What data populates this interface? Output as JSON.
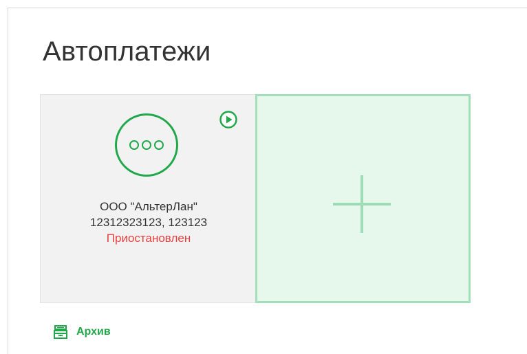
{
  "page": {
    "title": "Автоплатежи"
  },
  "card": {
    "avatar_icon": "ellipsis-icon",
    "play_icon": "play-circle-icon",
    "org_name": "ООО \"АльтерЛан\"",
    "account_numbers": "12312323123, 123123",
    "status": "Приостановлен"
  },
  "add_tile": {
    "icon": "plus-icon"
  },
  "archive": {
    "icon": "archive-box-icon",
    "label": "Архив"
  },
  "colors": {
    "accent_green": "#21a84a",
    "status_red": "#e83e3e",
    "tile_bg": "#f2f2f2",
    "add_tile_bg": "#e6f7ec",
    "add_tile_border": "#a3dfbb"
  }
}
